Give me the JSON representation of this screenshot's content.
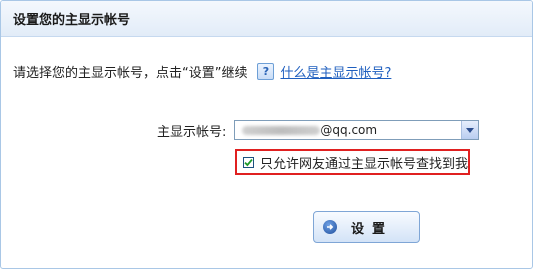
{
  "header": {
    "title": "设置您的主显示帐号"
  },
  "prompt": {
    "text": "请选择您的主显示帐号，点击“设置”继续",
    "help_icon_glyph": "?",
    "help_link": "什么是主显示帐号?"
  },
  "account_field": {
    "label": "主显示帐号:",
    "value_visible_suffix": "@qq.com"
  },
  "checkbox": {
    "label": "只允许网友通过主显示帐号查找到我",
    "checked": true
  },
  "submit": {
    "label": "设置"
  },
  "colors": {
    "highlight_border": "#e02020",
    "link": "#1f5fbf"
  }
}
